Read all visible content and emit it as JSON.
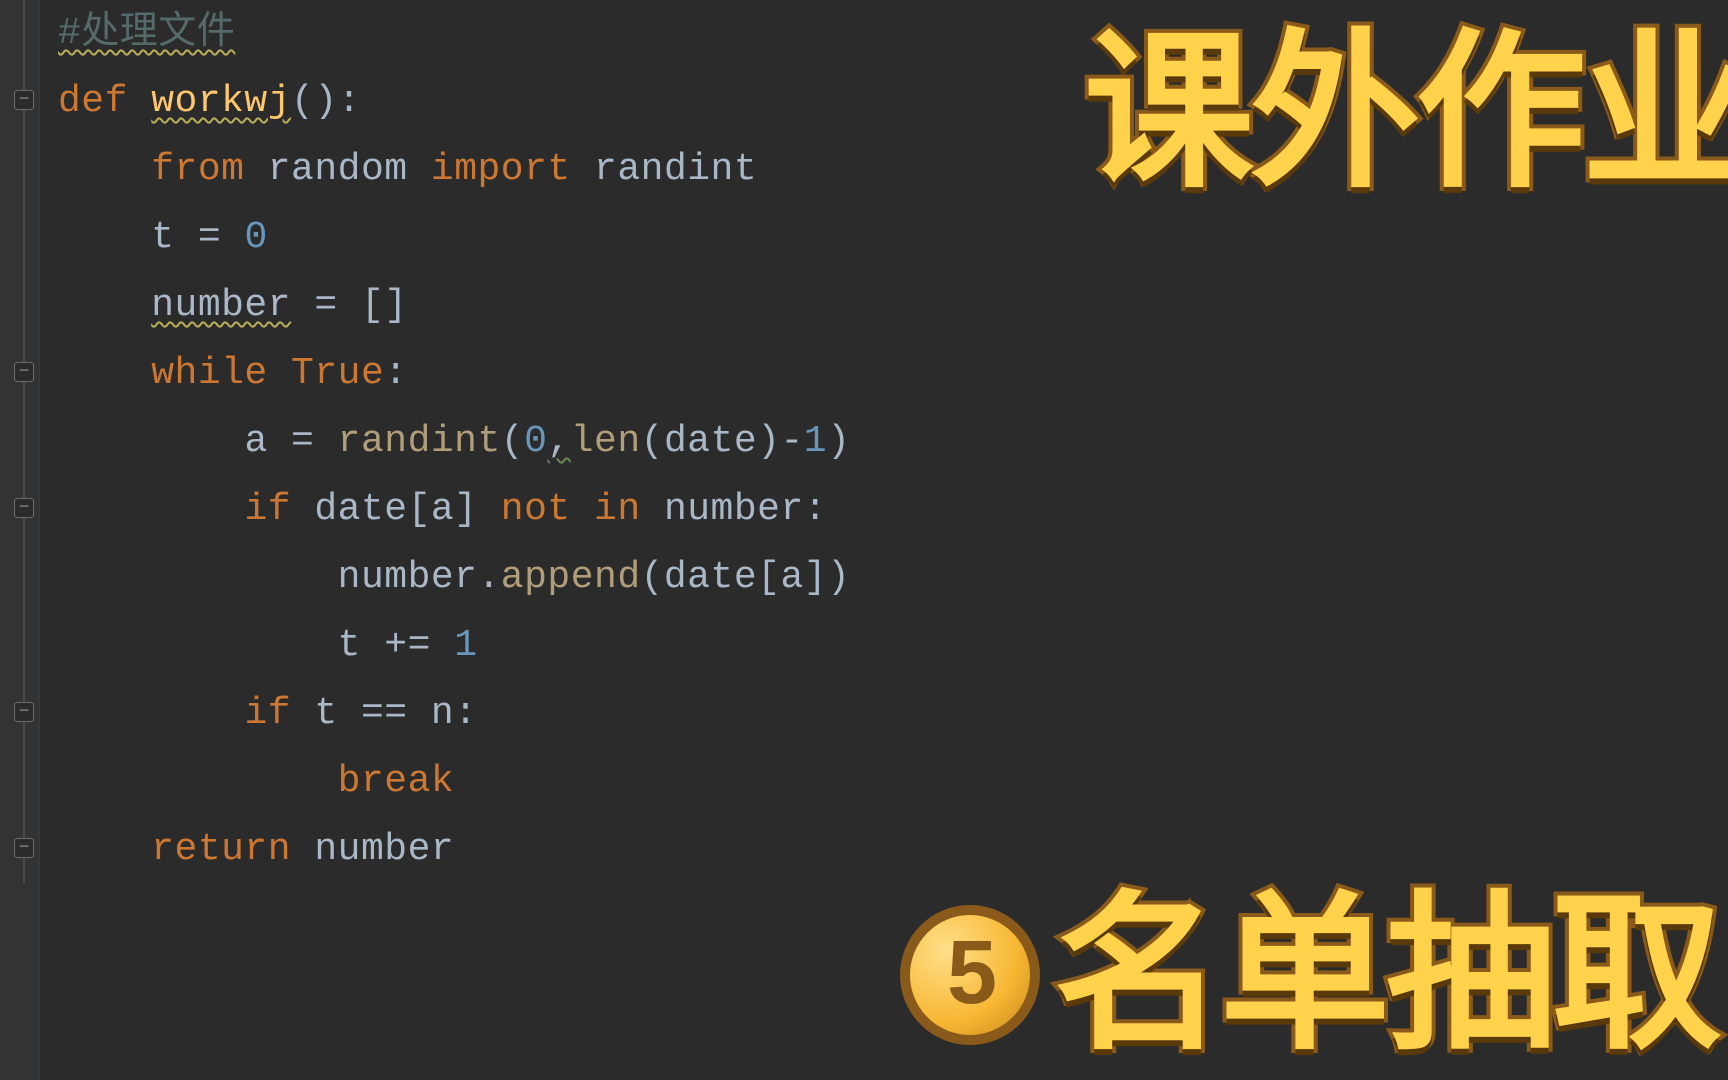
{
  "overlay": {
    "top_title": "课外作业",
    "bottom_title": "名单抽取",
    "badge_label": "5"
  },
  "code": {
    "lines": [
      {
        "indent": 0,
        "tokens": [
          {
            "t": "#处理文件",
            "c": "comment wavy-yellow"
          }
        ],
        "fold": null
      },
      {
        "indent": 0,
        "tokens": [
          {
            "t": "def ",
            "c": "kw"
          },
          {
            "t": "workwj",
            "c": "fn wavy-yellow"
          },
          {
            "t": "():",
            "c": "op"
          }
        ],
        "fold": "open"
      },
      {
        "indent": 1,
        "tokens": [
          {
            "t": "from ",
            "c": "kw"
          },
          {
            "t": "random ",
            "c": "self"
          },
          {
            "t": "import ",
            "c": "kw"
          },
          {
            "t": "randint",
            "c": "self"
          }
        ],
        "fold": null
      },
      {
        "indent": 1,
        "tokens": [
          {
            "t": "t = ",
            "c": "op"
          },
          {
            "t": "0",
            "c": "num"
          }
        ],
        "fold": null
      },
      {
        "indent": 1,
        "tokens": [
          {
            "t": "number",
            "c": "self wavy-yellow"
          },
          {
            "t": " = []",
            "c": "op"
          }
        ],
        "fold": null
      },
      {
        "indent": 1,
        "tokens": [
          {
            "t": "while ",
            "c": "kw"
          },
          {
            "t": "True",
            "c": "kw"
          },
          {
            "t": ":",
            "c": "op"
          }
        ],
        "fold": "open"
      },
      {
        "indent": 2,
        "tokens": [
          {
            "t": "a = ",
            "c": "op"
          },
          {
            "t": "randint",
            "c": "call"
          },
          {
            "t": "(",
            "c": "op"
          },
          {
            "t": "0",
            "c": "num"
          },
          {
            "t": ",",
            "c": "op wavy-green"
          },
          {
            "t": "len",
            "c": "call"
          },
          {
            "t": "(date)-",
            "c": "op"
          },
          {
            "t": "1",
            "c": "num"
          },
          {
            "t": ")",
            "c": "op"
          }
        ],
        "fold": null
      },
      {
        "indent": 2,
        "tokens": [
          {
            "t": "if ",
            "c": "kw"
          },
          {
            "t": "date[a] ",
            "c": "op"
          },
          {
            "t": "not in ",
            "c": "kw"
          },
          {
            "t": "number:",
            "c": "op"
          }
        ],
        "fold": "open"
      },
      {
        "indent": 3,
        "tokens": [
          {
            "t": "number.",
            "c": "op"
          },
          {
            "t": "append",
            "c": "call"
          },
          {
            "t": "(date[a])",
            "c": "op"
          }
        ],
        "fold": null
      },
      {
        "indent": 3,
        "tokens": [
          {
            "t": "t += ",
            "c": "op"
          },
          {
            "t": "1",
            "c": "num"
          }
        ],
        "fold": null
      },
      {
        "indent": 2,
        "tokens": [
          {
            "t": "if ",
            "c": "kw"
          },
          {
            "t": "t == n:",
            "c": "op"
          }
        ],
        "fold": "open"
      },
      {
        "indent": 3,
        "tokens": [
          {
            "t": "break",
            "c": "kw"
          }
        ],
        "fold": null
      },
      {
        "indent": 1,
        "tokens": [
          {
            "t": "return ",
            "c": "kw"
          },
          {
            "t": "number",
            "c": "op"
          }
        ],
        "fold": "open"
      }
    ],
    "indent_unit": "    "
  }
}
